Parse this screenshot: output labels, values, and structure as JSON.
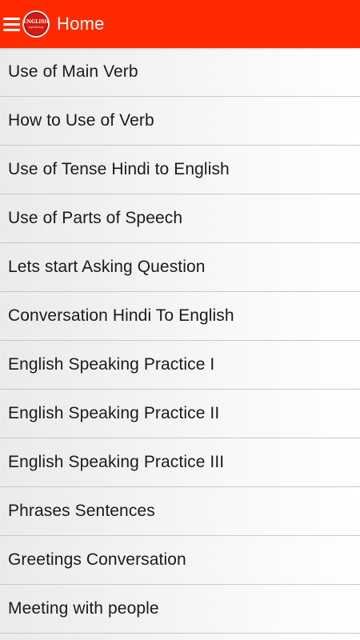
{
  "header": {
    "title": "Home",
    "background": "#ff2a00",
    "logo": {
      "line1": "ENGLISH",
      "line2": "speaking"
    }
  },
  "menu": {
    "items": [
      "Use of Main Verb",
      "How to Use of Verb",
      "Use of Tense Hindi to English",
      "Use of Parts of Speech",
      "Lets start Asking Question",
      "Conversation Hindi To English",
      "English Speaking Practice I",
      "English Speaking Practice II",
      "English Speaking Practice III",
      "Phrases Sentences",
      "Greetings Conversation",
      "Meeting with people"
    ]
  }
}
